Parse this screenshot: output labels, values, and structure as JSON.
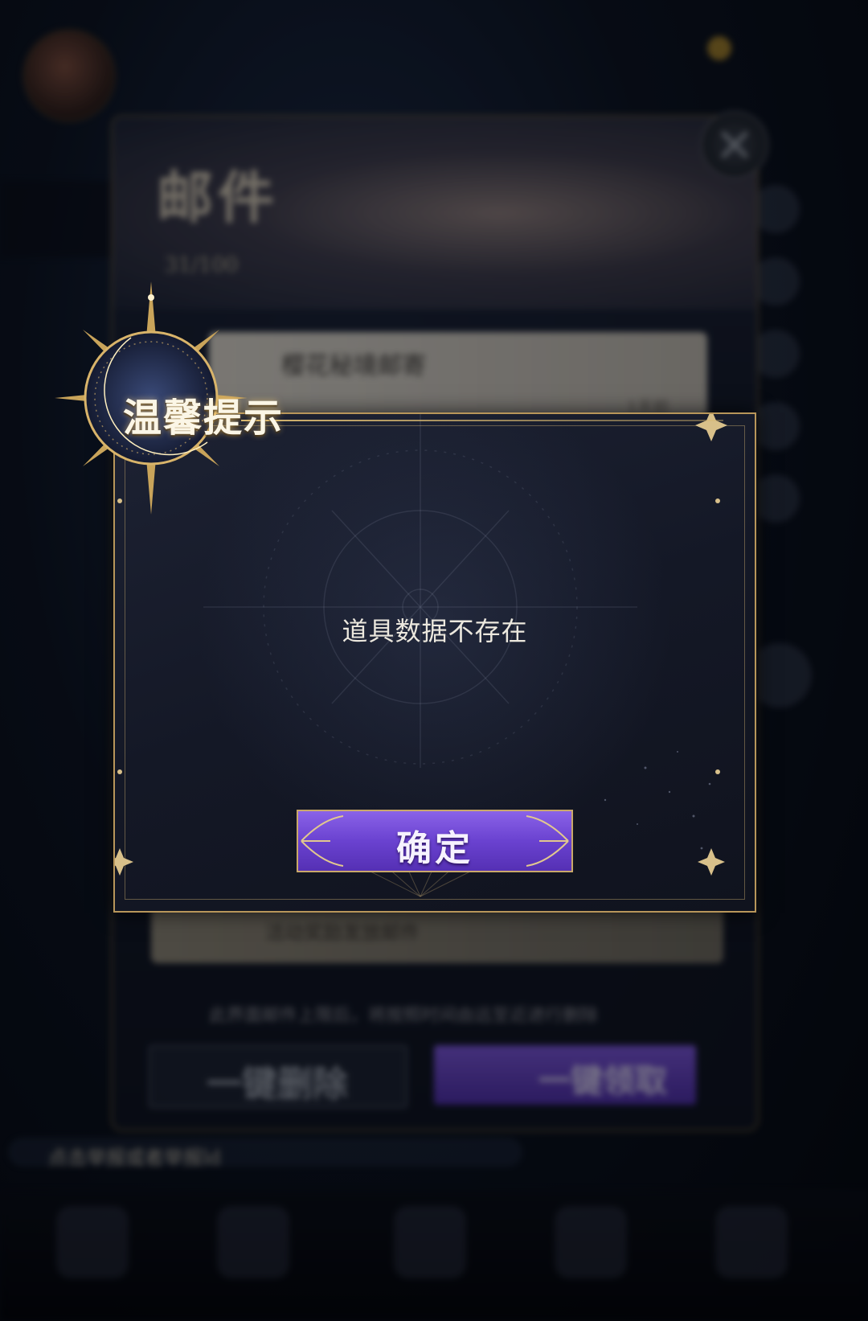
{
  "background": {
    "mail_window": {
      "title": "邮件",
      "count": "31/100",
      "item_title": "樱花秘境邮寄",
      "item_date": "1天前",
      "lower_item_text": "活动奖励发放邮件",
      "footer_note": "此界面邮件上限后，将按照时间由远至近进行删除",
      "delete_all_label": "一键删除",
      "claim_all_label": "一键领取"
    },
    "ticker_text": "点击举报或者举报ld"
  },
  "dialog": {
    "title": "温馨提示",
    "message": "道具数据不存在",
    "confirm_label": "确定"
  },
  "colors": {
    "accent_gold": "#b8965a",
    "button_purple": "#6a42d0",
    "dialog_bg": "#141826"
  },
  "icons": {
    "close": "close-icon",
    "title_emblem": "crescent-moon-sun-icon"
  }
}
